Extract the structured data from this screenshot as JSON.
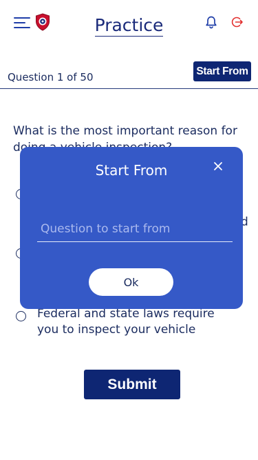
{
  "header": {
    "title": "Practice",
    "menu_icon": "hamburger-menu-icon",
    "logo_icon": "shield-logo-icon",
    "notification_icon": "bell-icon",
    "logout_icon": "logout-icon"
  },
  "quiz": {
    "question_counter": "Question 1 of 50",
    "start_from_label": "Start From",
    "question_text": "What is the most important reason for doing a vehicle inspection?",
    "clipped_text": "d",
    "visible_option_text": "Federal and state laws require you to inspect your vehicle",
    "submit_label": "Submit"
  },
  "dialog": {
    "title": "Start From",
    "input_placeholder": "Question to start from",
    "input_value": "",
    "ok_label": "Ok",
    "close_icon": "close-icon"
  },
  "colors": {
    "primary_navy": "#0e2673",
    "dialog_blue": "#3559c7",
    "text_navy": "#1c2d60",
    "logout_red": "#e2302f",
    "shield_red": "#c8102e"
  }
}
